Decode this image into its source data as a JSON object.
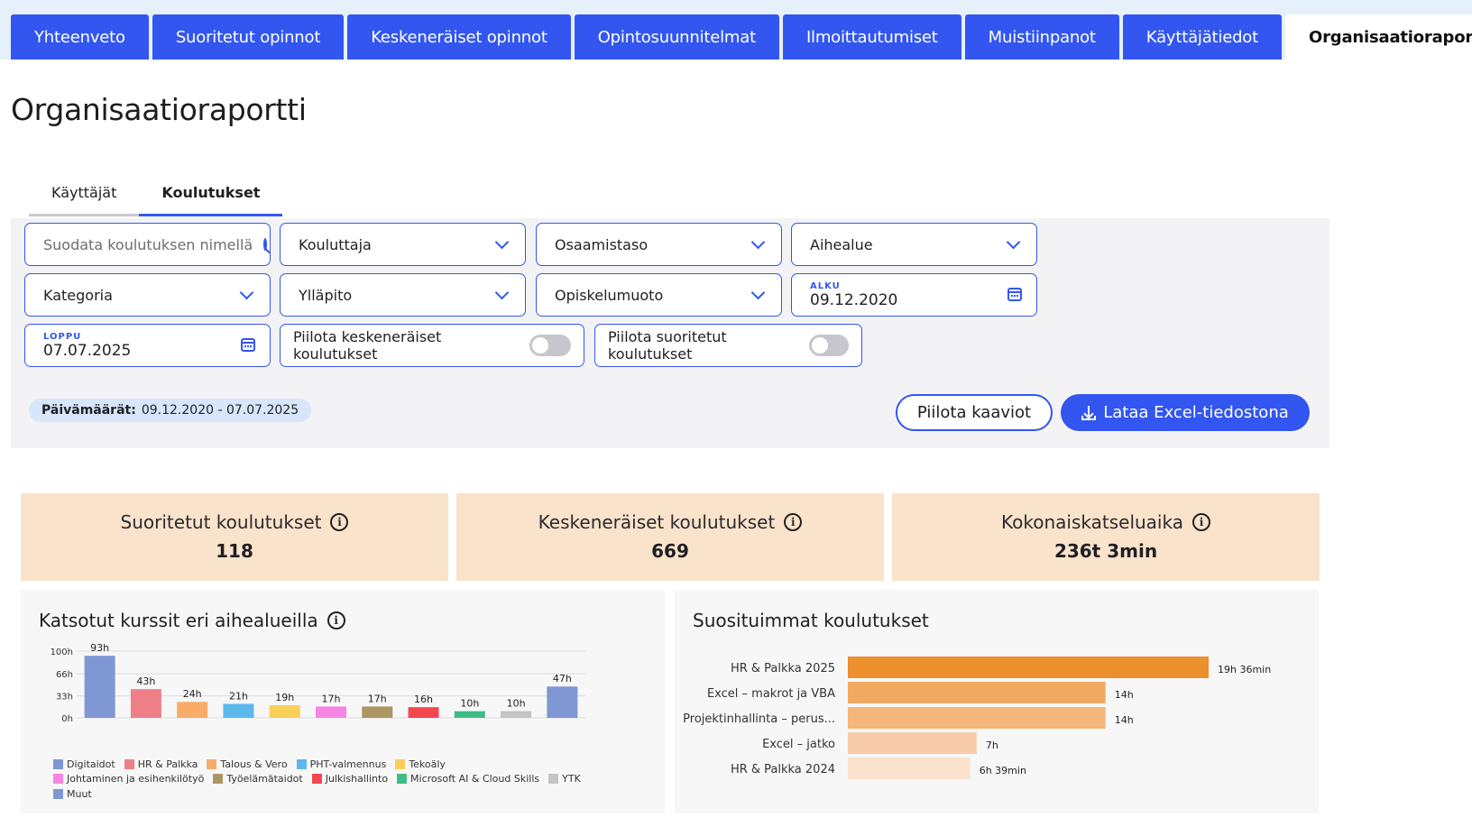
{
  "nav": {
    "tabs": [
      {
        "label": "Yhteenveto",
        "active": false
      },
      {
        "label": "Suoritetut opinnot",
        "active": false
      },
      {
        "label": "Keskeneräiset opinnot",
        "active": false
      },
      {
        "label": "Opintosuunnitelmat",
        "active": false
      },
      {
        "label": "Ilmoittautumiset",
        "active": false
      },
      {
        "label": "Muistiinpanot",
        "active": false
      },
      {
        "label": "Käyttäjätiedot",
        "active": false
      },
      {
        "label": "Organisaatioraportti",
        "active": true
      }
    ]
  },
  "page": {
    "title": "Organisaatioraportti"
  },
  "subtabs": [
    {
      "label": "Käyttäjät",
      "active": false
    },
    {
      "label": "Koulutukset",
      "active": true
    }
  ],
  "filters": {
    "search_placeholder": "Suodata koulutuksen nimellä",
    "kouluttaja": "Kouluttaja",
    "osaamistaso": "Osaamistaso",
    "aihealue": "Aihealue",
    "kategoria": "Kategoria",
    "yllapito": "Ylläpito",
    "opiskelumuoto": "Opiskelumuoto",
    "start_label": "ALKU",
    "start_value": "09.12.2020",
    "end_label": "LOPPU",
    "end_value": "07.07.2025",
    "hide_incomplete": "Piilota keskeneräiset koulutukset",
    "hide_completed": "Piilota suoritetut koulutukset",
    "date_chip_label": "Päivämäärät:",
    "date_chip_value": "09.12.2020 - 07.07.2025",
    "hide_charts_button": "Piilota kaaviot",
    "download_button": "Lataa Excel-tiedostona"
  },
  "kpis": [
    {
      "title": "Suoritetut koulutukset",
      "value": "118"
    },
    {
      "title": "Keskeneräiset koulutukset",
      "value": "669"
    },
    {
      "title": "Kokonaiskatseluaika",
      "value": "236t 3min"
    }
  ],
  "colors": {
    "accent": "#3356f0",
    "kpi_bg": "#fae3cb"
  },
  "chart_data": [
    {
      "type": "bar",
      "title": "Katsotut kurssit eri aihealueilla",
      "y_ticks": [
        "100h",
        "66h",
        "33h",
        "0h"
      ],
      "ylim": [
        0,
        100
      ],
      "categories": [
        "Digitaidot",
        "HR & Palkka",
        "Talous & Vero",
        "PHT-valmennus",
        "Tekoäly",
        "Johtaminen ja esihenkilötyö",
        "Työelämätaidot",
        "Julkishallinto",
        "Microsoft AI & Cloud Skills",
        "YTK",
        "Muut"
      ],
      "values": [
        93,
        43,
        24,
        21,
        19,
        17,
        17,
        16,
        10,
        10,
        47
      ],
      "data_labels": [
        "93h",
        "43h",
        "24h",
        "21h",
        "19h",
        "17h",
        "17h",
        "16h",
        "10h",
        "10h",
        "47h"
      ],
      "colors": [
        "#7f97d3",
        "#ee7f86",
        "#f9ac6a",
        "#5db9ec",
        "#f9cf57",
        "#f686e3",
        "#ac9664",
        "#f3474f",
        "#3fbd86",
        "#c4c4c4",
        "#7f97d3"
      ],
      "legend": "bottom"
    },
    {
      "type": "bar",
      "orientation": "horizontal",
      "title": "Suosituimmat koulutukset",
      "categories": [
        "HR & Palkka 2025",
        "Excel – makrot ja VBA",
        "Projektinhallinta – perus...",
        "Excel – jatko",
        "HR & Palkka 2024"
      ],
      "values_minutes": [
        1176,
        840,
        840,
        420,
        399
      ],
      "data_labels": [
        "19h 36min",
        "14h",
        "14h",
        "7h",
        "6h 39min"
      ],
      "colors": [
        "#ec8f2d",
        "#f2aa62",
        "#f4b67a",
        "#f8ccab",
        "#fae2cd"
      ]
    }
  ]
}
